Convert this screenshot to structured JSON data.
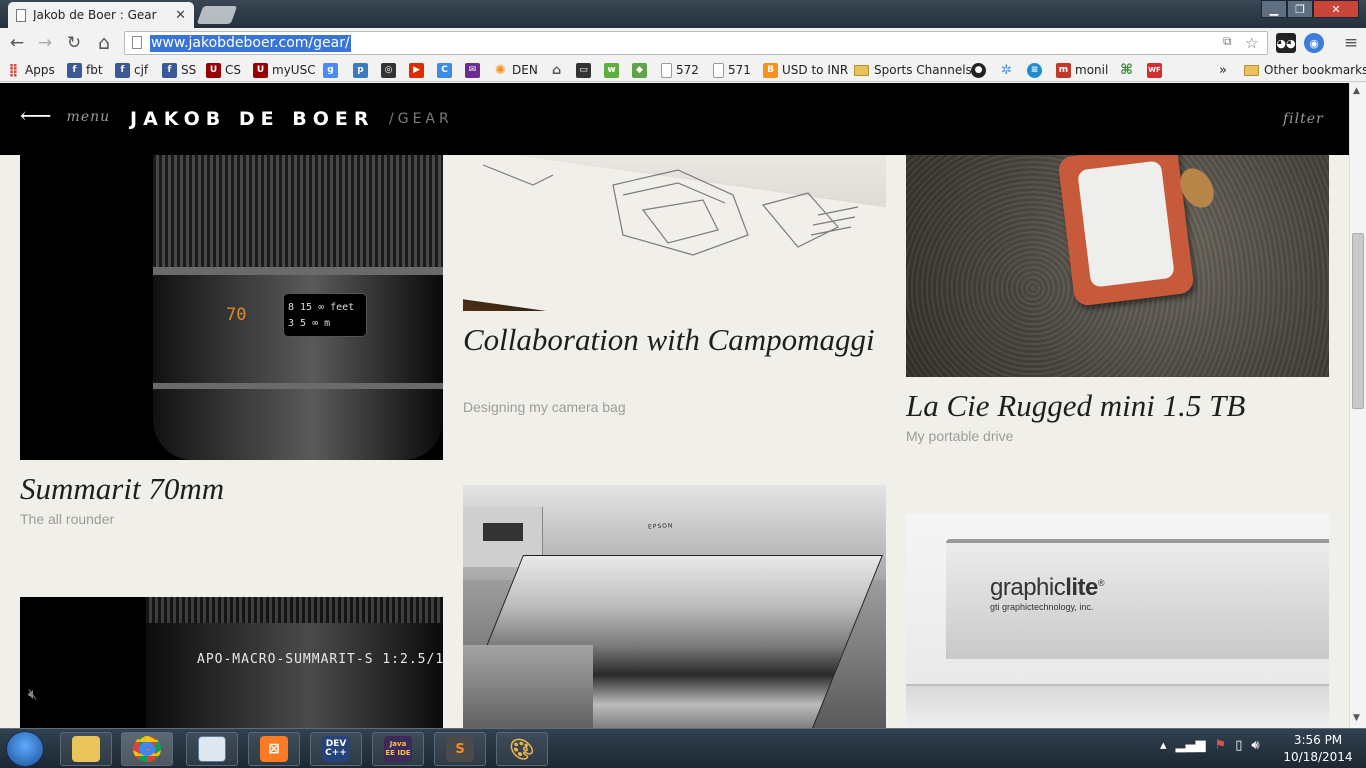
{
  "browser": {
    "tab_title": "Jakob de Boer : Gear",
    "tab_close": "✕",
    "url": "www.jakobdeboer.com/gear/",
    "window_controls": {
      "minimize": "▁",
      "maximize": "❐",
      "close": "✕"
    },
    "nav": {
      "back": "←",
      "forward": "→",
      "reload": "↻",
      "home": "⌂",
      "menu": "≡",
      "star": "☆"
    }
  },
  "bookmarks": {
    "items": [
      {
        "label": "Apps",
        "icon": "apps-grid-icon",
        "color": "#d24b3a"
      },
      {
        "label": "fbt",
        "icon": "facebook-icon",
        "color": "#3b5998"
      },
      {
        "label": "cjf",
        "icon": "facebook-icon",
        "color": "#3b5998"
      },
      {
        "label": "SS",
        "icon": "facebook-icon",
        "color": "#3b5998"
      },
      {
        "label": "CS",
        "icon": "usc-icon",
        "color": "#990000"
      },
      {
        "label": "myUSC",
        "icon": "usc-icon",
        "color": "#990000"
      },
      {
        "label": "",
        "icon": "google-icon",
        "color": "#4a8af4"
      },
      {
        "label": "",
        "icon": "p-icon",
        "color": "#3c7bbf"
      },
      {
        "label": "",
        "icon": "camera-icon",
        "color": "#333333"
      },
      {
        "label": "",
        "icon": "youtube-icon",
        "color": "#dd2c00"
      },
      {
        "label": "",
        "icon": "c-icon",
        "color": "#3c8ce7"
      },
      {
        "label": "",
        "icon": "mail-icon",
        "color": "#6a2c91"
      },
      {
        "label": "DEN",
        "icon": "den-icon",
        "color": "#f29120"
      },
      {
        "label": "",
        "icon": "bank-icon",
        "color": "#555555"
      },
      {
        "label": "",
        "icon": "tv-icon",
        "color": "#333333"
      },
      {
        "label": "",
        "icon": "w3-icon",
        "color": "#5faf3f"
      },
      {
        "label": "",
        "icon": "maps-icon",
        "color": "#62a34b"
      },
      {
        "label": "572",
        "icon": "page-icon",
        "color": "#999999"
      },
      {
        "label": "571",
        "icon": "page-icon",
        "color": "#999999"
      },
      {
        "label": "USD to INR",
        "icon": "b-icon",
        "color": "#f7931a"
      },
      {
        "label": "Sports Channels",
        "icon": "folder-icon",
        "color": "#e8c15f"
      },
      {
        "label": "",
        "icon": "github-icon",
        "color": "#222222"
      },
      {
        "label": "",
        "icon": "bug-icon",
        "color": "#4e8fd8"
      },
      {
        "label": "",
        "icon": "att-icon",
        "color": "#1f8ccf"
      },
      {
        "label": "monil",
        "icon": "m-icon",
        "color": "#c0392b"
      },
      {
        "label": "",
        "icon": "clover-icon",
        "color": "#2e8b2e"
      },
      {
        "label": "",
        "icon": "wf-icon",
        "color": "#d32f2f"
      }
    ],
    "overflow": "»",
    "other": "Other bookmarks"
  },
  "site": {
    "menu_arrow": "⟵",
    "menu_label": "menu",
    "title": "JAKOB DE BOER",
    "section": "/GEAR",
    "filter_label": "filter"
  },
  "gear": [
    {
      "title": "Summarit 70mm",
      "subtitle": "The all rounder",
      "lens_marking": "70",
      "scale_top": "8 15 ∞ feet",
      "scale_bottom": "3 5 ∞ m"
    },
    {
      "title": "Collaboration with Campomaggi",
      "subtitle": "Designing my camera bag"
    },
    {
      "title": "La Cie Rugged mini 1.5 TB",
      "subtitle": "My portable drive"
    },
    {
      "lens_marking": "APO-MACRO-SUMMARIT-S 1:2.5/1"
    },
    {
      "printer_brand": "EPSON"
    },
    {
      "brand": "graphiclite",
      "brand_bold": "lite",
      "brand_small": "gti graphictechnology, inc."
    }
  ],
  "taskbar": {
    "time": "3:56 PM",
    "date": "10/18/2014",
    "apps": [
      {
        "name": "explorer",
        "label": ""
      },
      {
        "name": "chrome",
        "label": ""
      },
      {
        "name": "notepad",
        "label": ""
      },
      {
        "name": "xampp",
        "label": ""
      },
      {
        "name": "devcpp",
        "label": "DEV C++"
      },
      {
        "name": "javaee",
        "label": "Java EE IDE"
      },
      {
        "name": "sublime",
        "label": "S"
      },
      {
        "name": "paint",
        "label": ""
      }
    ]
  }
}
